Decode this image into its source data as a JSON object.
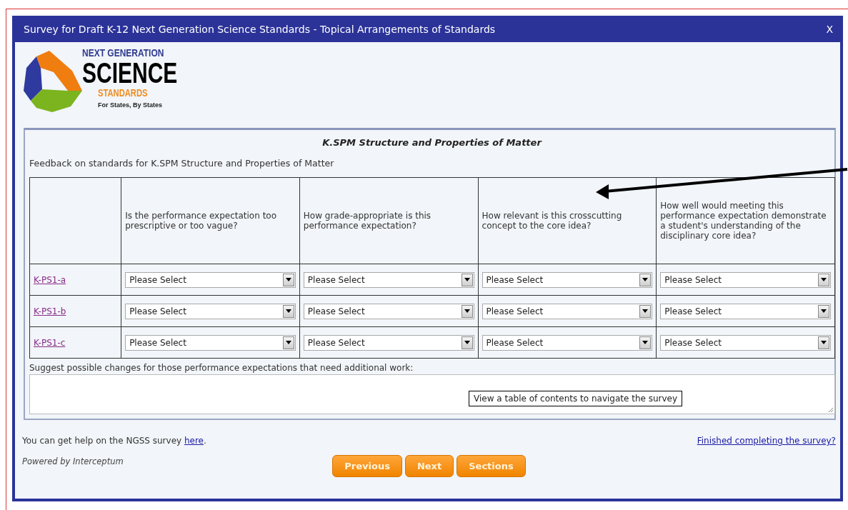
{
  "window": {
    "title": "Survey for Draft K-12 Next Generation Science Standards - Topical Arrangements of Standards",
    "close": "X"
  },
  "logo": {
    "line1": "NEXT GENERATION",
    "line2": "SCIENCE",
    "line3": "STANDARDS",
    "tagline": "For States, By States"
  },
  "section": {
    "heading": "K.SPM Structure and Properties of Matter",
    "intro": "Feedback on standards for K.SPM Structure and Properties of Matter",
    "columns": [
      "Is the performance expectation too prescriptive or too vague?",
      "How grade-appropriate is this performance expectation?",
      "How relevant is this crosscutting concept to the core idea?",
      "How well would meeting this performance expectation demonstrate a student's understanding of the disciplinary core idea?"
    ],
    "rows": [
      {
        "code": "K-PS1-a",
        "answers": [
          "Please Select",
          "Please Select",
          "Please Select",
          "Please Select"
        ]
      },
      {
        "code": "K-PS1-b",
        "answers": [
          "Please Select",
          "Please Select",
          "Please Select",
          "Please Select"
        ]
      },
      {
        "code": "K-PS1-c",
        "answers": [
          "Please Select",
          "Please Select",
          "Please Select",
          "Please Select"
        ]
      }
    ],
    "suggest_label": "Suggest possible changes for those performance expectations that need additional work:",
    "tooltip": "View a table of contents to navigate the survey"
  },
  "footer": {
    "help_text": "You can get help on the NGSS survey ",
    "help_link": "here",
    "help_end": ".",
    "finished_link": "Finished completing the survey?",
    "powered_by": "Powered by Interceptum",
    "buttons": [
      "Previous",
      "Next",
      "Sections"
    ]
  }
}
